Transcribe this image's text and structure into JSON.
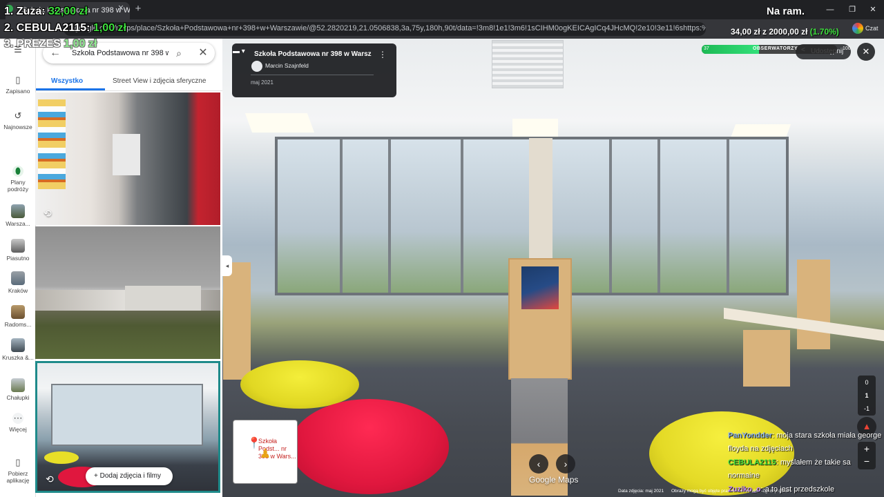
{
  "browser": {
    "tab_title": "Szkoła Podstawowa nr 398 w Wars",
    "tab_close": "✕",
    "new_tab": "+",
    "url": "google.com/maps/place/Szkoła+Podstawowa+nr+398+w+Warszawie/@52.2820219,21.0506838,3a,75y,180h,90t/data=!3m8!1e1!3m6!1sCIHM0ogKEICAgICq4JHcMQ!2e10!3e11!6shttps:%2F%2Flh3.googleusercontent.com%2Fgpms-cs-s%2",
    "profile_label": "Czat",
    "window_controls": [
      "—",
      "❐",
      "✕"
    ]
  },
  "rail": {
    "items": [
      {
        "label": "Zapisano",
        "icon": "bookmark-icon",
        "glyph": "▯"
      },
      {
        "label": "Najnowsze",
        "icon": "history-icon",
        "glyph": "↺"
      },
      {
        "label": "Plany podróży",
        "icon": "trip-plan-icon",
        "glyph": "⬮"
      },
      {
        "label": "Warsza...",
        "icon": "recent-place-thumb"
      },
      {
        "label": "Piasutno",
        "icon": "recent-place-thumb"
      },
      {
        "label": "Kraków",
        "icon": "recent-place-thumb"
      },
      {
        "label": "Radoms...",
        "icon": "recent-place-thumb"
      },
      {
        "label": "Kruszka &...",
        "icon": "recent-place-thumb"
      },
      {
        "label": "Chałupki",
        "icon": "recent-place-thumb"
      },
      {
        "label": "Więcej",
        "icon": "more-icon",
        "glyph": "⋯"
      },
      {
        "label": "Pobierz aplikację",
        "icon": "phone-icon",
        "glyph": "▯"
      }
    ]
  },
  "panel": {
    "search_value": "Szkoła Podstawowa nr 398 w",
    "back_glyph": "←",
    "search_glyph": "⌕",
    "clear_glyph": "✕",
    "tabs": [
      "Wszystko",
      "Street View i zdjęcia sferyczne"
    ],
    "add_photos": "Dodaj zdjęcia i filmy",
    "add_glyph": "+",
    "sv360_glyph": "⟲"
  },
  "streetview": {
    "title": "Szkoła Podstawowa nr 398 w Warsz...",
    "menu_glyph": "⋮",
    "author": "Marcin Szajnfeld",
    "date": "maj 2021",
    "share": "Udostępnij",
    "share_glyph": "<",
    "close_glyph": "✕",
    "collapse_glyph": "◂",
    "minimap_label": "Szkoła Podst... nr 398 w Wars...",
    "minimap_pin": "📍",
    "pegman": "♟",
    "nav_prev": "‹",
    "nav_next": "›",
    "logo": "Google Maps",
    "footer_date": "Data zdjęcia: maj 2021",
    "footer_more": "Obrazy mogą być objęte prawami autorskimi. Zgłoś problem",
    "zoom_levels": [
      "0",
      "1",
      "-1"
    ],
    "compass_glyph": "▲",
    "zoom_in": "+",
    "zoom_out": "−"
  },
  "stream": {
    "ranking": [
      {
        "name": "1. Zuza:",
        "amount": "32,00 zł"
      },
      {
        "name": "2. CEBULA2115:",
        "amount": "1,00 zł"
      },
      {
        "name": "3. PREZES",
        "amount": "1,00 zł"
      }
    ],
    "na_ram": "Na ram.",
    "goal": {
      "current": "34,00 zł",
      "sep": " z ",
      "target": "2000,00 zł",
      "percent": "(1.70%)",
      "fill_fraction": 0.017,
      "bar_label": "OBSERWATORZY",
      "left_num": "37",
      "right_num": "100"
    },
    "chat": [
      {
        "user": "PanYondder",
        "text": ": moja stara szkoła miała george floyda na zdjęciach",
        "color": "#8ab4f8"
      },
      {
        "user": "CEBULA2115",
        "text": ": myślałem że takie sa normaine",
        "color": "#3ee03e"
      },
      {
        "user": "Zuziko_o",
        "text": ": a to jest przedszkole",
        "color": "#c58af9"
      }
    ]
  }
}
